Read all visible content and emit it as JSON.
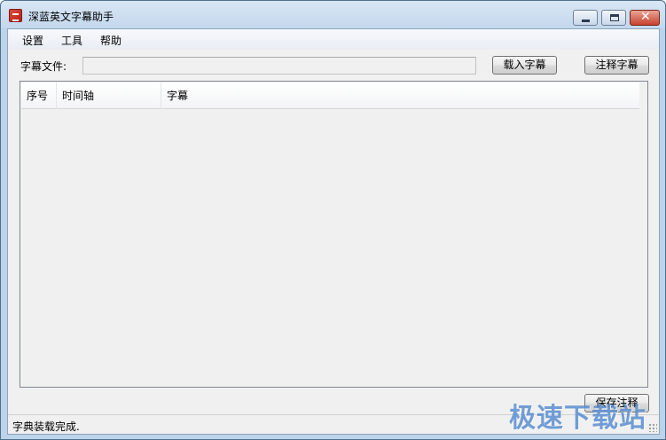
{
  "window": {
    "title": "深蓝英文字幕助手"
  },
  "titlebar_buttons": {
    "minimize_icon": "minimize-icon",
    "maximize_icon": "maximize-icon",
    "close_icon": "close-icon",
    "close_glyph": "✕"
  },
  "menu": {
    "items": [
      "设置",
      "工具",
      "帮助"
    ]
  },
  "file": {
    "label": "字幕文件:",
    "value": "",
    "placeholder": ""
  },
  "buttons": {
    "load": "载入字幕",
    "annotate": "注释字幕",
    "save": "保存注释"
  },
  "table": {
    "columns": [
      "序号",
      "时间轴",
      "字幕"
    ],
    "rows": []
  },
  "status": {
    "text": "字典装载完成."
  },
  "watermark": {
    "text": "极速下载站"
  }
}
